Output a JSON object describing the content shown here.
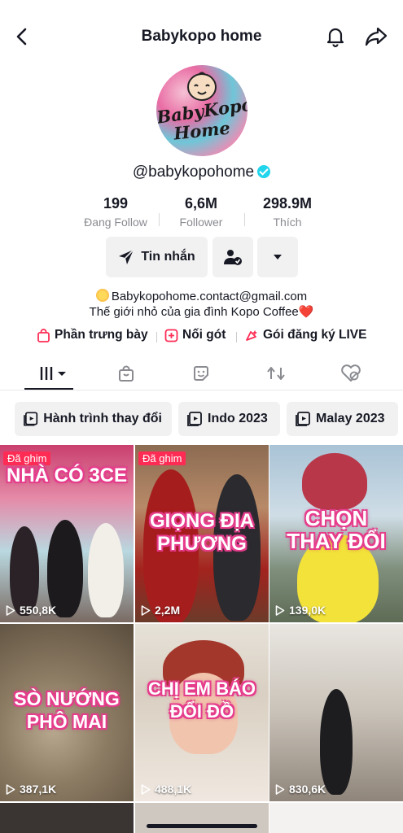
{
  "header": {
    "title": "Babykopo home"
  },
  "avatar": {
    "logo_line1": "BabyKopo",
    "logo_line2": "Home"
  },
  "profile": {
    "handle": "@babykopohome"
  },
  "stats": [
    {
      "value": "199",
      "label": "Đang Follow"
    },
    {
      "value": "6,6M",
      "label": "Follower"
    },
    {
      "value": "298.9M",
      "label": "Thích"
    }
  ],
  "actions": {
    "message_label": "Tin nhắn"
  },
  "bio": {
    "line1": "Babykopohome.contact@gmail.com",
    "line2": "Thế giới nhỏ của gia đình Kopo Coffee",
    "heart": "❤️"
  },
  "links": [
    {
      "label": "Phần trưng bày"
    },
    {
      "label": "Nối gót"
    },
    {
      "label": "Gói đăng ký LIVE"
    }
  ],
  "playlists": [
    {
      "label": "Hành trình thay đổi"
    },
    {
      "label": "Indo 2023"
    },
    {
      "label": "Malay 2023"
    }
  ],
  "videos": [
    {
      "pinned": "Đã ghim",
      "caption": "NHÀ CÓ 3CE",
      "views": "550,8K"
    },
    {
      "pinned": "Đã ghim",
      "caption": "GIỌNG ĐỊA PHƯƠNG",
      "views": "2,2M"
    },
    {
      "pinned": "",
      "caption": "CHỌN THAY ĐỔI",
      "views": "139,0K"
    },
    {
      "pinned": "",
      "caption": "SÒ NƯỚNG PHÔ MAI",
      "views": "387,1K"
    },
    {
      "pinned": "",
      "caption": "CHỊ EM BÁO ĐỔI ĐỒ",
      "views": "488,1K"
    },
    {
      "pinned": "",
      "caption": "",
      "views": "830,6K"
    }
  ],
  "colors": {
    "accent": "#fe2c55",
    "verified": "#20d5ec",
    "chip_bg": "#f1f1f2"
  }
}
